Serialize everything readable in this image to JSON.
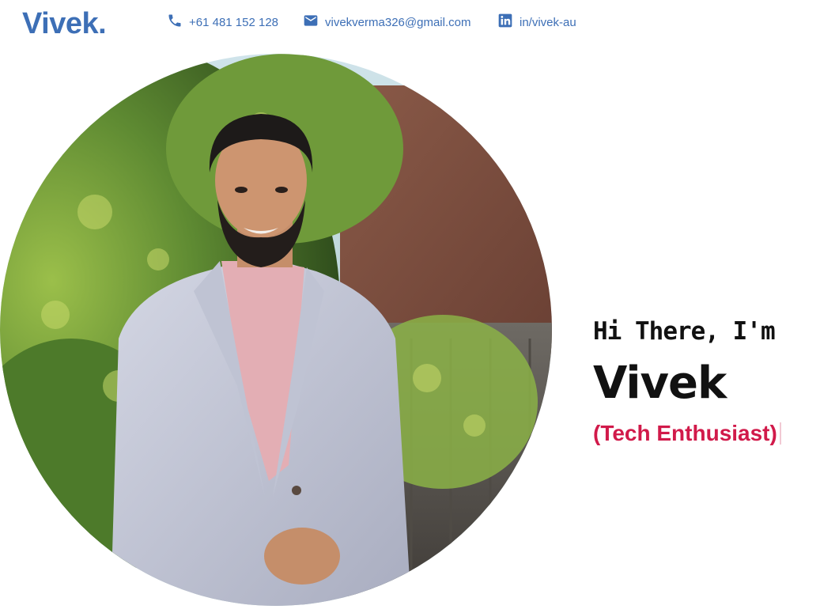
{
  "header": {
    "logo": "Vivek.",
    "phone": {
      "icon": "phone-icon",
      "text": "+61 481 152 128"
    },
    "email": {
      "icon": "mail-icon",
      "text": "vivekverma326@gmail.com"
    },
    "linkedin": {
      "icon": "linkedin-icon",
      "text": "in/vivek-au"
    }
  },
  "hero": {
    "photo_icon": "profile-photo",
    "greeting": "Hi There, I'm",
    "name": "Vivek",
    "role": "(Tech Enthusiast)"
  },
  "colors": {
    "brand": "#3d6fb6",
    "accent": "#d11a4a",
    "text": "#111111"
  }
}
